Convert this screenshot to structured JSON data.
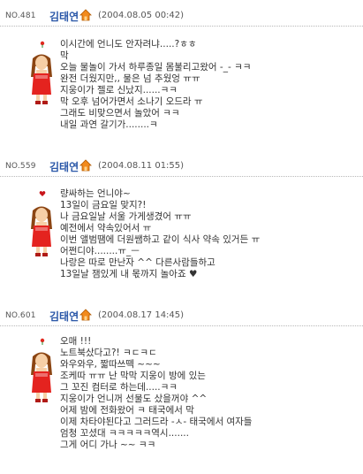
{
  "posts": [
    {
      "no": "NO.481",
      "author": "김태연",
      "date": "(2004.08.05 00:42)",
      "lines": [
        "이시간에 언니도 안자려냐.....?ㅎㅎ",
        "막",
        "오늘 물놀이 가서 하루종일 몸불리고왔어 -_- ㅋㅋ",
        "완전 더웠지만,, 물은 넘 추웠엉 ㅠㅠ",
        "지웅이가 젤로 신났지......ㅋㅋ",
        "막 오후 넘어가면서 소나기 오드라 ㅠ",
        "그래도 비맞으면서 놀았어 ㅋㅋ",
        "내일 과연 갈기가........ㅋ"
      ]
    },
    {
      "no": "NO.559",
      "author": "김태연",
      "date": "(2004.08.11 01:55)",
      "lines": [
        "량싸하는 언니야~",
        "13일이 금요일 맞지?!",
        "나 금요일날 서울 가게생겼어 ㅠㅠ",
        "예전에서 약속있어서 ㅠ",
        "이번 앨범땜에 더원쌤하고 같이 식사 약속 있거든 ㅠ",
        "어쩐디야........ㅠ_ㅡ",
        "나랑은 따로 만난자 ^^ 다른사람들하고",
        "13일날 잼있게 내 몫까지 놀아죠 ♥"
      ]
    },
    {
      "no": "NO.601",
      "author": "김태연",
      "date": "(2004.08.17 14:45)",
      "lines": [
        "오매 !!!",
        "노트북샀다고?! ㅋㄷㅋㄷ",
        "와우와우, 짧따쓰떽 ~~~",
        "조케따 ㅠㅠ 난 막막 지웅이 방에 있는",
        "그 꼬진 컴터로 하는데.....ㅋㅋ",
        "지웅이가 언니꺼 선물도 샀을꺼야 ^^",
        "어제 밤에 전화왔어 ㅋ 태국에서 막",
        "이제 차타야된다고 그러드라 -ㅅ- 태국에서 여자들",
        "엄청 꼬셨대 ㅋㅋㅋㅋㅋ역시.......",
        "그게 어디 가나 ~~ ㅋㅋ"
      ]
    }
  ]
}
